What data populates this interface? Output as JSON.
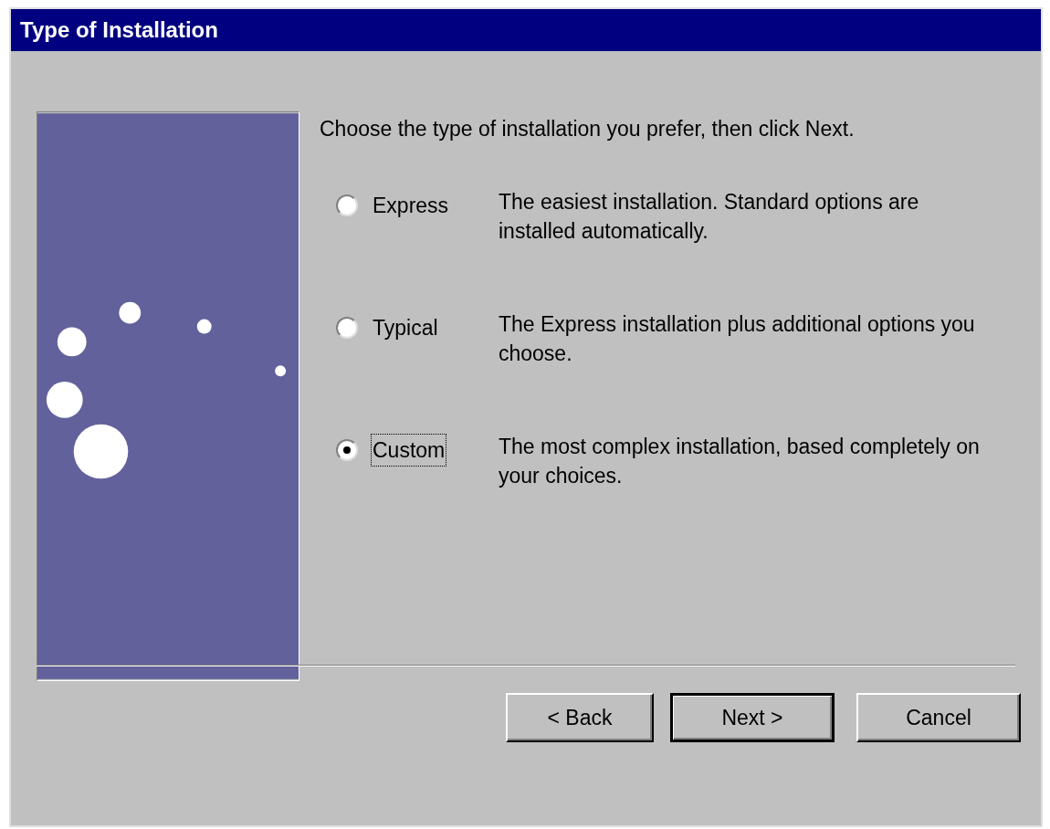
{
  "window": {
    "title": "Type of Installation"
  },
  "instruction": "Choose the type of installation you prefer, then click Next.",
  "options": [
    {
      "label": "Express",
      "description": "The easiest installation. Standard options are installed automatically.",
      "selected": false,
      "focused": false
    },
    {
      "label": "Typical",
      "description": "The Express installation plus additional options you choose.",
      "selected": false,
      "focused": false
    },
    {
      "label": "Custom",
      "description": "The most complex installation, based completely on your choices.",
      "selected": true,
      "focused": true
    }
  ],
  "buttons": [
    {
      "label": "< Back",
      "default": false
    },
    {
      "label": "Next >",
      "default": true
    },
    {
      "label": "Cancel",
      "default": false
    }
  ]
}
